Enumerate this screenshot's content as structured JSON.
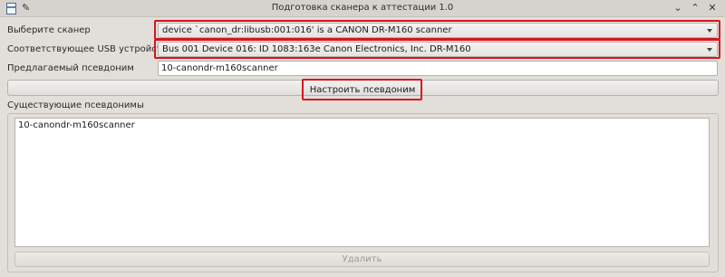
{
  "window": {
    "title": "Подготовка сканера к аттестации 1.0",
    "icons": {
      "app": "window-app-icon",
      "pin": "pin-icon",
      "minimize": "chevron-down-icon",
      "maximize": "chevron-up-icon",
      "close": "close-icon"
    }
  },
  "form": {
    "scanner_label": "Выберите сканер",
    "scanner_value": "device `canon_dr:libusb:001:016' is a CANON DR-M160 scanner",
    "usb_label": "Соответствующее USB устройство",
    "usb_value": "Bus 001 Device 016: ID 1083:163e Canon Electronics, Inc. DR-M160",
    "alias_label": "Предлагаемый псевдоним",
    "alias_value": "10-canondr-m160scanner",
    "setup_button": "Настроить псевдоним"
  },
  "existing": {
    "label": "Существующие псевдонимы",
    "items": [
      "10-canondr-m160scanner"
    ],
    "delete_button": "Удалить"
  },
  "colors": {
    "highlight": "#d9141e",
    "background": "#e2dfda"
  }
}
